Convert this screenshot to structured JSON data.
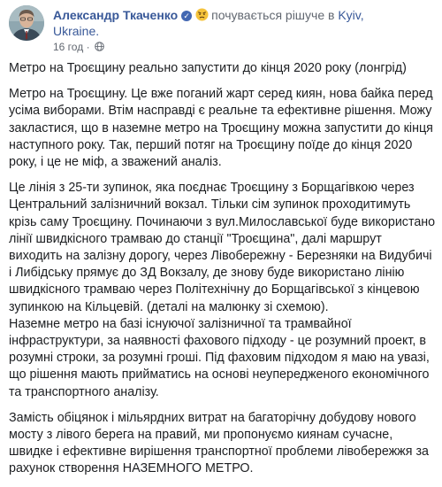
{
  "post": {
    "author": "Александр Ткаченко",
    "feeling_text": "почувається рішуче в",
    "place_part1": "Kyiv,",
    "place_part2": "Ukraine.",
    "timestamp": "16 год",
    "separator": "·",
    "icons": {
      "verified": "verified-badge-icon",
      "feeling": "determined-face-emoji",
      "privacy": "globe-icon"
    },
    "accent_color": "#385898",
    "paragraphs": [
      "Метро на Троєщину реально запустити до кінця 2020 року (лонгрід)",
      "Метро на Троєщину. Це вже поганий жарт серед киян, нова байка перед усіма виборами. Втім насправді є реальне та ефективне рішення. Можу закластися, що в наземне метро на Троєщину можна запустити до кінця наступного року. Так, перший потяг на Троєщину поїде до кінця 2020 року, і це не міф, а зважений аналіз.",
      "Це лінія з 25-ти зупинок, яка поєднає Троєщину з Борщагівкою через Центральний залізничний вокзал. Тільки сім зупинок проходитимуть крізь саму Троєщину. Починаючи з вул.Милославської буде використано лінії швидкісного трамваю до станції \"Троєщина\", далі маршрут виходить на залізну дорогу, через Лівобережну - Березняки на Видубичі і Либідську прямує до ЗД Вокзалу, де знову буде використано лінію швидкісного трамваю через Політехнічну до Борщагівської з кінцевою зупинкою на Кільцевій. (деталі на малюнку зі схемою).",
      "Наземне метро на базі існуючої залізничної та трамвайної інфраструктури, за наявності фахового підходу - це розумний проект, в розумні строки, за розумні гроші. Під фаховим підходом я маю на увазі, що рішення мають прийматись на основі неупередженого економічного та транспортного аналізу.",
      "Замість обіцянок і мільярдних витрат на багаторічну добудову нового мосту з лівого берега на правий, ми пропонуємо киянам сучасне, швидке і ефективне вирішення транспортної проблеми лівобережжя за рахунок створення НАЗЕМНОГО МЕТРО."
    ]
  }
}
